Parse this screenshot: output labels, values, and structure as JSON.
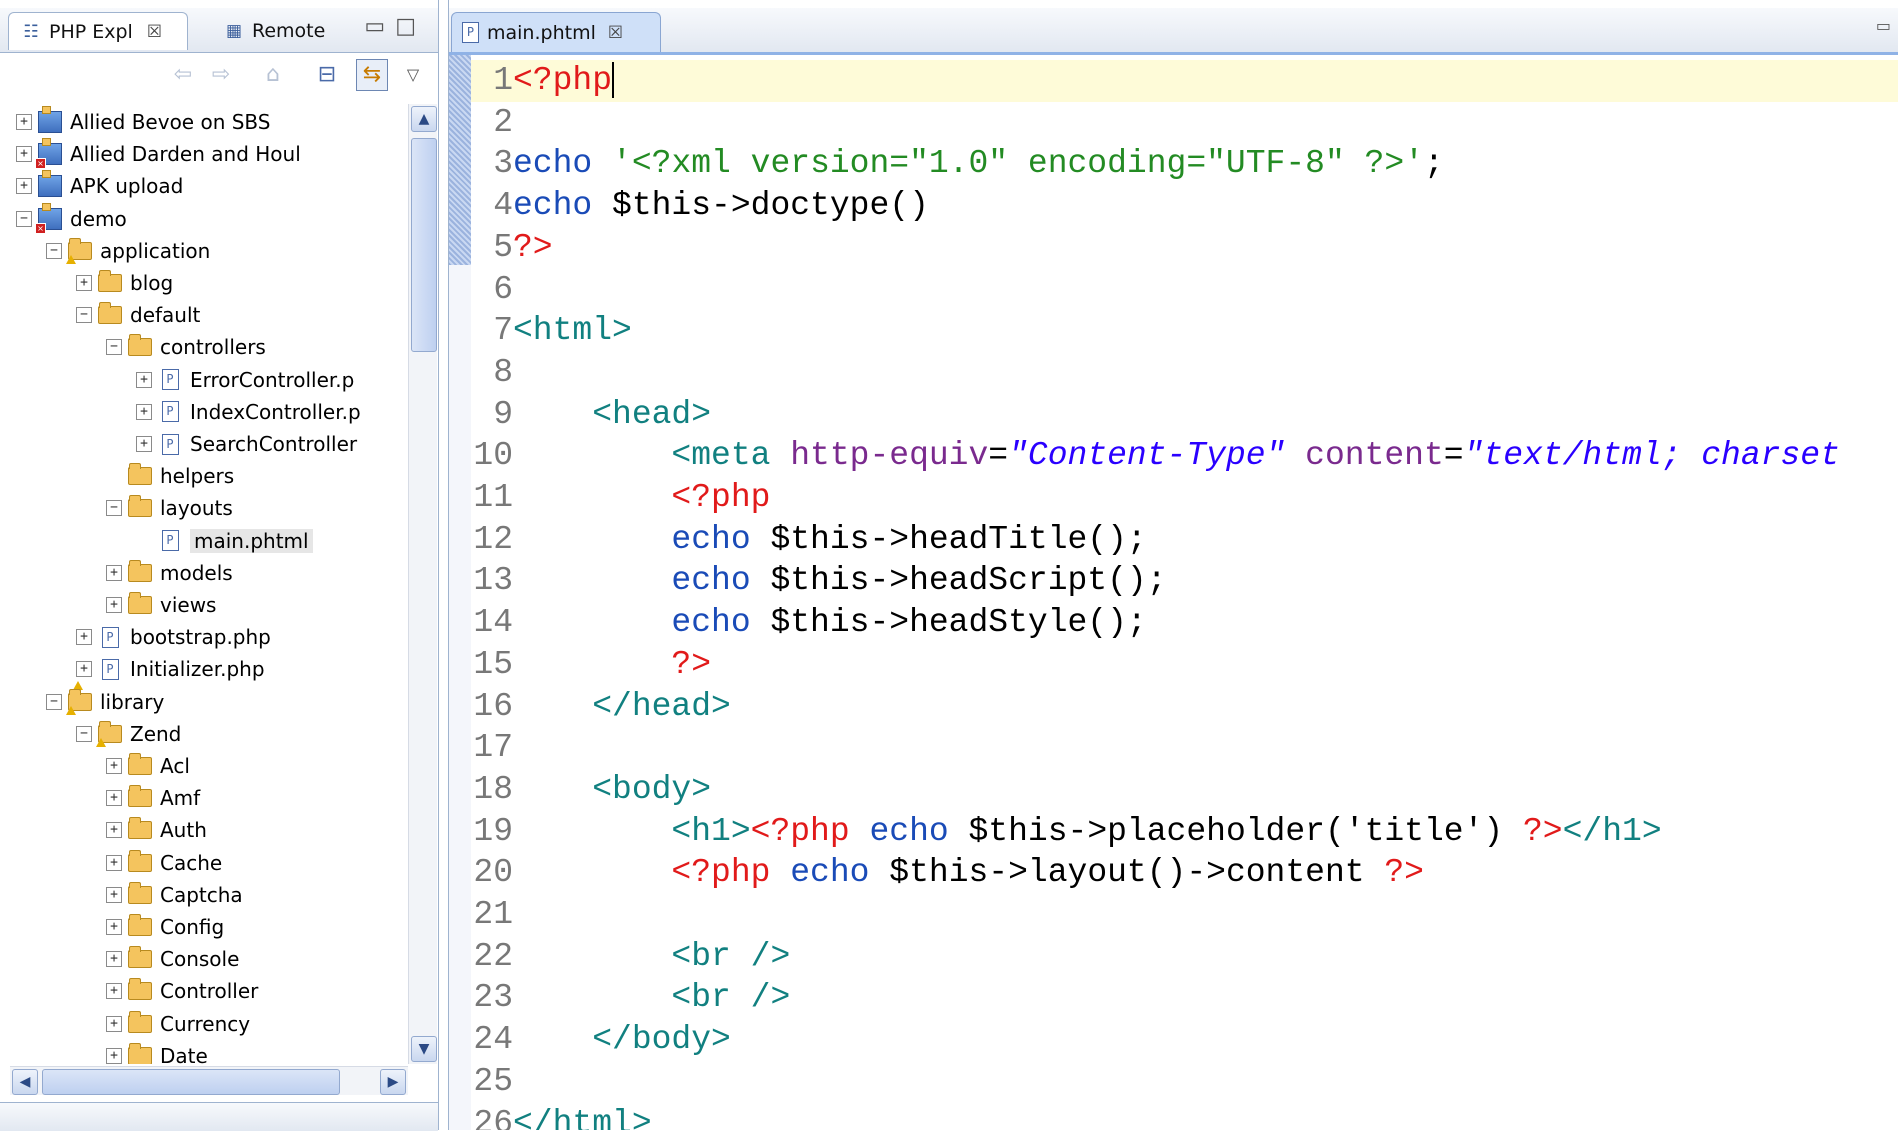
{
  "explorer": {
    "tabs": [
      {
        "label": "PHP Expl",
        "close": "☒",
        "icon": "php-explorer-icon"
      },
      {
        "label": "Remote",
        "icon": "remote-systems-icon"
      }
    ],
    "toolbar": [
      "back-icon",
      "forward-icon",
      "up-icon",
      "collapse-all-icon",
      "link-with-editor-icon",
      "view-menu-icon"
    ],
    "tree": [
      {
        "label": "Allied Bevoe on SBS",
        "type": "project",
        "expand": "+",
        "depth": 0
      },
      {
        "label": "Allied Darden and Houl",
        "type": "project",
        "badge": "error",
        "expand": "+",
        "depth": 0
      },
      {
        "label": "APK upload",
        "type": "project",
        "expand": "+",
        "depth": 0
      },
      {
        "label": "demo",
        "type": "project",
        "badge": "error",
        "expand": "-",
        "depth": 0
      },
      {
        "label": "application",
        "type": "folder",
        "badge": "warning",
        "expand": "-",
        "depth": 1
      },
      {
        "label": "blog",
        "type": "folder",
        "expand": "+",
        "depth": 2
      },
      {
        "label": "default",
        "type": "folder",
        "expand": "-",
        "depth": 2
      },
      {
        "label": "controllers",
        "type": "folder",
        "expand": "-",
        "depth": 3
      },
      {
        "label": "ErrorController.p",
        "type": "php",
        "expand": "+",
        "depth": 4
      },
      {
        "label": "IndexController.p",
        "type": "php",
        "expand": "+",
        "depth": 4
      },
      {
        "label": "SearchController",
        "type": "php",
        "expand": "+",
        "depth": 4
      },
      {
        "label": "helpers",
        "type": "folder",
        "expand": "",
        "depth": 3
      },
      {
        "label": "layouts",
        "type": "folder",
        "expand": "-",
        "depth": 3
      },
      {
        "label": "main.phtml",
        "type": "php",
        "expand": "",
        "depth": 4,
        "selected": true
      },
      {
        "label": "models",
        "type": "folder",
        "expand": "+",
        "depth": 3
      },
      {
        "label": "views",
        "type": "folder",
        "expand": "+",
        "depth": 3
      },
      {
        "label": "bootstrap.php",
        "type": "php",
        "expand": "+",
        "depth": 2
      },
      {
        "label": "Initializer.php",
        "type": "php",
        "badge": "warning",
        "expand": "+",
        "depth": 2
      },
      {
        "label": "library",
        "type": "folder",
        "badge": "warning",
        "expand": "-",
        "depth": 1
      },
      {
        "label": "Zend",
        "type": "folder",
        "badge": "warning",
        "expand": "-",
        "depth": 2
      },
      {
        "label": "Acl",
        "type": "folder",
        "expand": "+",
        "depth": 3
      },
      {
        "label": "Amf",
        "type": "folder",
        "expand": "+",
        "depth": 3
      },
      {
        "label": "Auth",
        "type": "folder",
        "expand": "+",
        "depth": 3
      },
      {
        "label": "Cache",
        "type": "folder",
        "expand": "+",
        "depth": 3
      },
      {
        "label": "Captcha",
        "type": "folder",
        "expand": "+",
        "depth": 3
      },
      {
        "label": "Config",
        "type": "folder",
        "expand": "+",
        "depth": 3
      },
      {
        "label": "Console",
        "type": "folder",
        "expand": "+",
        "depth": 3
      },
      {
        "label": "Controller",
        "type": "folder",
        "expand": "+",
        "depth": 3
      },
      {
        "label": "Currency",
        "type": "folder",
        "expand": "+",
        "depth": 3
      },
      {
        "label": "Date",
        "type": "folder",
        "expand": "+",
        "depth": 3
      }
    ]
  },
  "editor": {
    "tab": {
      "label": "main.phtml",
      "close": "☒",
      "icon": "php-file-icon"
    },
    "current_line": 1,
    "lines": [
      [
        {
          "t": "<?php",
          "c": "php"
        }
      ],
      [],
      [
        {
          "t": "echo",
          "c": "kw"
        },
        {
          "t": " ",
          "c": "plain"
        },
        {
          "t": "'<?xml version=\"1.0\" encoding=\"UTF-8\" ?>'",
          "c": "str"
        },
        {
          "t": ";",
          "c": "plain"
        }
      ],
      [
        {
          "t": "echo",
          "c": "kw"
        },
        {
          "t": " $this->doctype()",
          "c": "plain"
        }
      ],
      [
        {
          "t": "?>",
          "c": "php"
        }
      ],
      [],
      [
        {
          "t": "<html>",
          "c": "tag"
        }
      ],
      [],
      [
        {
          "t": "    <head>",
          "c": "tag"
        }
      ],
      [
        {
          "t": "        <meta ",
          "c": "tag"
        },
        {
          "t": "http-equiv",
          "c": "attr"
        },
        {
          "t": "=",
          "c": "plain"
        },
        {
          "t": "\"Content-Type\"",
          "c": "aval"
        },
        {
          "t": " content",
          "c": "attr"
        },
        {
          "t": "=",
          "c": "plain"
        },
        {
          "t": "\"text/html; charset",
          "c": "aval"
        }
      ],
      [
        {
          "t": "        <?php",
          "c": "php"
        }
      ],
      [
        {
          "t": "        echo",
          "c": "kw"
        },
        {
          "t": " $this->headTitle();",
          "c": "plain"
        }
      ],
      [
        {
          "t": "        echo",
          "c": "kw"
        },
        {
          "t": " $this->headScript();",
          "c": "plain"
        }
      ],
      [
        {
          "t": "        echo",
          "c": "kw"
        },
        {
          "t": " $this->headStyle();",
          "c": "plain"
        }
      ],
      [
        {
          "t": "        ?>",
          "c": "php"
        }
      ],
      [
        {
          "t": "    </head>",
          "c": "tag"
        }
      ],
      [],
      [
        {
          "t": "    <body>",
          "c": "tag"
        }
      ],
      [
        {
          "t": "        <h1>",
          "c": "tag"
        },
        {
          "t": "<?php",
          "c": "php"
        },
        {
          "t": " echo",
          "c": "kw"
        },
        {
          "t": " $this->placeholder('title') ",
          "c": "plain"
        },
        {
          "t": "?>",
          "c": "php"
        },
        {
          "t": "</h1>",
          "c": "tag"
        }
      ],
      [
        {
          "t": "        <?php",
          "c": "php"
        },
        {
          "t": " echo",
          "c": "kw"
        },
        {
          "t": " $this->layout()->content ",
          "c": "plain"
        },
        {
          "t": "?>",
          "c": "php"
        }
      ],
      [],
      [
        {
          "t": "        <br />",
          "c": "tag"
        }
      ],
      [
        {
          "t": "        <br />",
          "c": "tag"
        }
      ],
      [
        {
          "t": "    </body>",
          "c": "tag"
        }
      ],
      [],
      [
        {
          "t": "</html>",
          "c": "tag"
        }
      ]
    ]
  }
}
